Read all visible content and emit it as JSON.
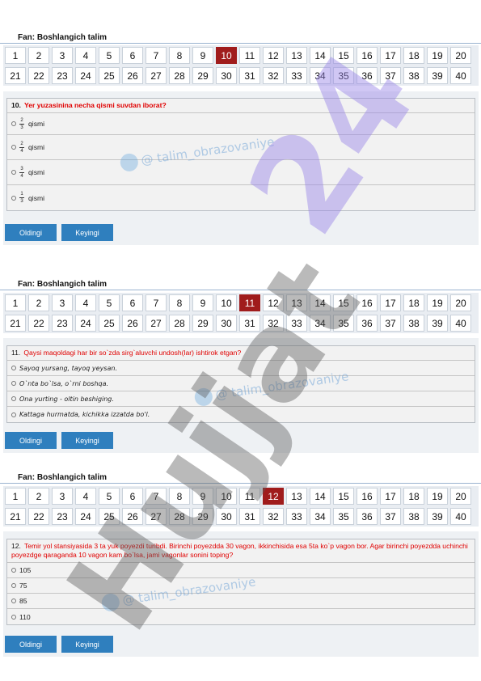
{
  "fan_label": "Fan:  Boshlangich talim",
  "numbers_row1": [
    "1",
    "2",
    "3",
    "4",
    "5",
    "6",
    "7",
    "8",
    "9",
    "10",
    "11",
    "12",
    "13",
    "14",
    "15",
    "16",
    "17",
    "18",
    "19",
    "20"
  ],
  "numbers_row2": [
    "21",
    "22",
    "23",
    "24",
    "25",
    "26",
    "27",
    "28",
    "29",
    "30",
    "31",
    "32",
    "33",
    "34",
    "35",
    "36",
    "37",
    "38",
    "39",
    "40"
  ],
  "buttons": {
    "prev": "Oldingi",
    "next": "Keyingi"
  },
  "watermarks": {
    "channel": "@ talim_obrazovaniye",
    "big_text": "Hujjat",
    "big_num": "24"
  },
  "colors": {
    "accent": "#a01c1c",
    "question": "#e00000",
    "button": "#2f7fbe"
  },
  "questions": [
    {
      "active": 10,
      "number": "10.",
      "text": "Yer yuzasinina necha qismi suvdan iborat?",
      "options": [
        {
          "num": "2",
          "den": "3",
          "label": "qismi"
        },
        {
          "num": "2",
          "den": "4",
          "label": "qismi"
        },
        {
          "num": "3",
          "den": "4",
          "label": "qismi"
        },
        {
          "num": "1",
          "den": "3",
          "label": "qismi"
        }
      ]
    },
    {
      "active": 11,
      "number": "11.",
      "text": "Qaysi maqoldagi har bir so`zda sirg`aluvchi undosh(lar) ishtirok etgan?",
      "options": [
        {
          "label": "Sayoq yursang, tayoq yeysan."
        },
        {
          "label": "O`nta bo`lsa, o`rni boshqa."
        },
        {
          "label": "Ona yurting - oltin beshiging."
        },
        {
          "label": "Kattaga hurmatda, kichikka izzatda bo'l."
        }
      ]
    },
    {
      "active": 12,
      "number": "12.",
      "text": "Temir yol stansiyasida  3 ta yuk poyezdi turibdi.  Birinchi poyezdda  30 vagon,  ikkinchisida esa 5ta ko`p vagon bor. Agar birinchi poyezdda uchinchi poyezdge  qaraganda 10 vagon kam bo`lsa, jami vagonlar sonini toping?",
      "options": [
        {
          "label": "105"
        },
        {
          "label": "75"
        },
        {
          "label": "85"
        },
        {
          "label": "110"
        }
      ]
    }
  ]
}
